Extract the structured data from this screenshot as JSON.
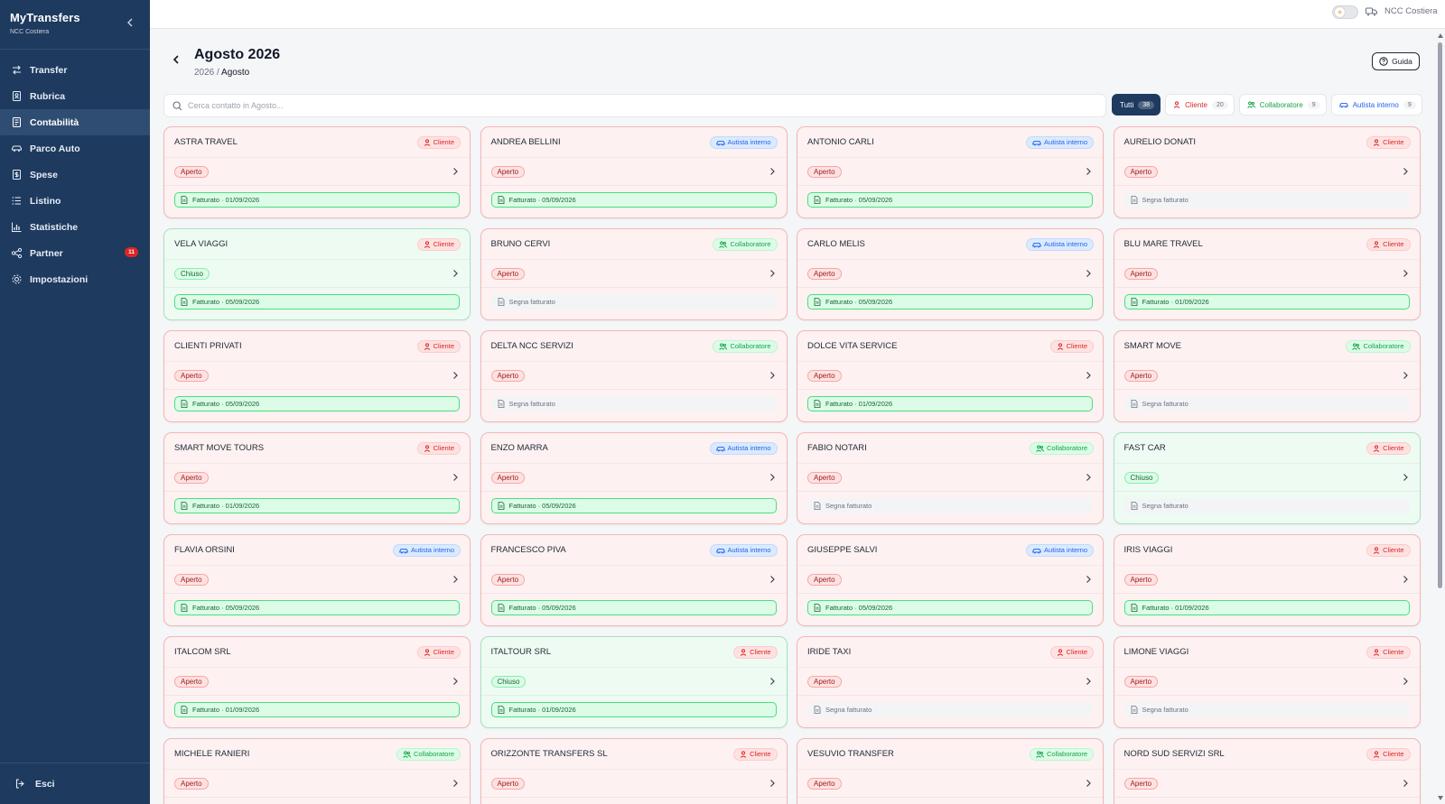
{
  "app": {
    "title": "MyTransfers",
    "company": "NCC Costiera"
  },
  "sidebar": {
    "items": [
      {
        "label": "Transfer",
        "icon": "arrows-swap-icon",
        "active": false
      },
      {
        "label": "Rubrica",
        "icon": "contact-book-icon",
        "active": false
      },
      {
        "label": "Contabilità",
        "icon": "ledger-icon",
        "active": true
      },
      {
        "label": "Parco Auto",
        "icon": "car-icon",
        "active": false
      },
      {
        "label": "Spese",
        "icon": "receipt-icon",
        "active": false
      },
      {
        "label": "Listino",
        "icon": "list-icon",
        "active": false
      },
      {
        "label": "Statistiche",
        "icon": "bar-chart-icon",
        "active": false
      },
      {
        "label": "Partner",
        "icon": "share-icon",
        "active": false,
        "badge": "11"
      },
      {
        "label": "Impostazioni",
        "icon": "gear-icon",
        "active": false
      }
    ],
    "logout_label": "Esci"
  },
  "topbar": {
    "company": "NCC Costiera"
  },
  "header": {
    "title": "Agosto 2026",
    "breadcrumb_year": "2026",
    "breadcrumb_sep": "/",
    "breadcrumb_month": "Agosto",
    "guide_label": "Guida"
  },
  "search": {
    "placeholder": "Cerca contatto in Agosto..."
  },
  "filters": [
    {
      "label": "Tutti",
      "count": "38",
      "kind": "all",
      "active": true
    },
    {
      "label": "Cliente",
      "count": "20",
      "kind": "cliente",
      "active": false
    },
    {
      "label": "Collaboratore",
      "count": "9",
      "kind": "collab",
      "active": false
    },
    {
      "label": "Autista interno",
      "count": "9",
      "kind": "autista",
      "active": false
    }
  ],
  "cards": [
    {
      "name": "ASTRA TRAVEL",
      "type": "Cliente",
      "kind": "cliente",
      "status": "Aperto",
      "closed": false,
      "invoice": "Fatturato · 01/09/2026",
      "invoiced": true
    },
    {
      "name": "ANDREA BELLINI",
      "type": "Autista interno",
      "kind": "autista",
      "status": "Aperto",
      "closed": false,
      "invoice": "Fatturato · 05/09/2026",
      "invoiced": true
    },
    {
      "name": "ANTONIO CARLI",
      "type": "Autista interno",
      "kind": "autista",
      "status": "Aperto",
      "closed": false,
      "invoice": "Fatturato · 05/09/2026",
      "invoiced": true
    },
    {
      "name": "AURELIO DONATI",
      "type": "Cliente",
      "kind": "cliente",
      "status": "Aperto",
      "closed": false,
      "invoice": "Segna fatturato",
      "invoiced": false
    },
    {
      "name": "VELA VIAGGI",
      "type": "Cliente",
      "kind": "cliente",
      "status": "Chiuso",
      "closed": true,
      "invoice": "Fatturato · 05/09/2026",
      "invoiced": true
    },
    {
      "name": "BRUNO CERVI",
      "type": "Collaboratore",
      "kind": "collab",
      "status": "Aperto",
      "closed": false,
      "invoice": "Segna fatturato",
      "invoiced": false
    },
    {
      "name": "CARLO MELIS",
      "type": "Autista interno",
      "kind": "autista",
      "status": "Aperto",
      "closed": false,
      "invoice": "Fatturato · 05/09/2026",
      "invoiced": true
    },
    {
      "name": "BLU MARE TRAVEL",
      "type": "Cliente",
      "kind": "cliente",
      "status": "Aperto",
      "closed": false,
      "invoice": "Fatturato · 01/09/2026",
      "invoiced": true
    },
    {
      "name": "CLIENTI PRIVATI",
      "type": "Cliente",
      "kind": "cliente",
      "status": "Aperto",
      "closed": false,
      "invoice": "Fatturato · 05/09/2026",
      "invoiced": true
    },
    {
      "name": "DELTA NCC SERVIZI",
      "type": "Collaboratore",
      "kind": "collab",
      "status": "Aperto",
      "closed": false,
      "invoice": "Segna fatturato",
      "invoiced": false
    },
    {
      "name": "DOLCE VITA SERVICE",
      "type": "Cliente",
      "kind": "cliente",
      "status": "Aperto",
      "closed": false,
      "invoice": "Fatturato · 01/09/2026",
      "invoiced": true
    },
    {
      "name": "SMART MOVE",
      "type": "Collaboratore",
      "kind": "collab",
      "status": "Aperto",
      "closed": false,
      "invoice": "Segna fatturato",
      "invoiced": false
    },
    {
      "name": "SMART MOVE TOURS",
      "type": "Cliente",
      "kind": "cliente",
      "status": "Aperto",
      "closed": false,
      "invoice": "Fatturato · 01/09/2026",
      "invoiced": true
    },
    {
      "name": "ENZO MARRA",
      "type": "Autista interno",
      "kind": "autista",
      "status": "Aperto",
      "closed": false,
      "invoice": "Fatturato · 05/09/2026",
      "invoiced": true
    },
    {
      "name": "FABIO NOTARI",
      "type": "Collaboratore",
      "kind": "collab",
      "status": "Aperto",
      "closed": false,
      "invoice": "Segna fatturato",
      "invoiced": false
    },
    {
      "name": "FAST CAR",
      "type": "Cliente",
      "kind": "cliente",
      "status": "Chiuso",
      "closed": true,
      "invoice": "Segna fatturato",
      "invoiced": false
    },
    {
      "name": "FLAVIA ORSINI",
      "type": "Autista interno",
      "kind": "autista",
      "status": "Aperto",
      "closed": false,
      "invoice": "Fatturato · 05/09/2026",
      "invoiced": true
    },
    {
      "name": "FRANCESCO PIVA",
      "type": "Autista interno",
      "kind": "autista",
      "status": "Aperto",
      "closed": false,
      "invoice": "Fatturato · 05/09/2026",
      "invoiced": true
    },
    {
      "name": "GIUSEPPE SALVI",
      "type": "Autista interno",
      "kind": "autista",
      "status": "Aperto",
      "closed": false,
      "invoice": "Fatturato · 05/09/2026",
      "invoiced": true
    },
    {
      "name": "IRIS VIAGGI",
      "type": "Cliente",
      "kind": "cliente",
      "status": "Aperto",
      "closed": false,
      "invoice": "Fatturato · 01/09/2026",
      "invoiced": true
    },
    {
      "name": "ITALCOM SRL",
      "type": "Cliente",
      "kind": "cliente",
      "status": "Aperto",
      "closed": false,
      "invoice": "Fatturato · 01/09/2026",
      "invoiced": true
    },
    {
      "name": "ITALTOUR SRL",
      "type": "Cliente",
      "kind": "cliente",
      "status": "Chiuso",
      "closed": true,
      "invoice": "Fatturato · 01/09/2026",
      "invoiced": true
    },
    {
      "name": "IRIDE TAXI",
      "type": "Cliente",
      "kind": "cliente",
      "status": "Aperto",
      "closed": false,
      "invoice": "Segna fatturato",
      "invoiced": false
    },
    {
      "name": "LIMONE VIAGGI",
      "type": "Cliente",
      "kind": "cliente",
      "status": "Aperto",
      "closed": false,
      "invoice": "Segna fatturato",
      "invoiced": false
    },
    {
      "name": "MICHELE RANIERI",
      "type": "Collaboratore",
      "kind": "collab",
      "status": "Aperto",
      "closed": false,
      "invoice": "",
      "invoiced": false
    },
    {
      "name": "ORIZZONTE TRANSFERS SL",
      "type": "Cliente",
      "kind": "cliente",
      "status": "Aperto",
      "closed": false,
      "invoice": "",
      "invoiced": false
    },
    {
      "name": "VESUVIO TRANSFER",
      "type": "Collaboratore",
      "kind": "collab",
      "status": "Aperto",
      "closed": false,
      "invoice": "",
      "invoiced": false
    },
    {
      "name": "NORD SUD SERVIZI SRL",
      "type": "Cliente",
      "kind": "cliente",
      "status": "Aperto",
      "closed": false,
      "invoice": "",
      "invoiced": false
    }
  ]
}
